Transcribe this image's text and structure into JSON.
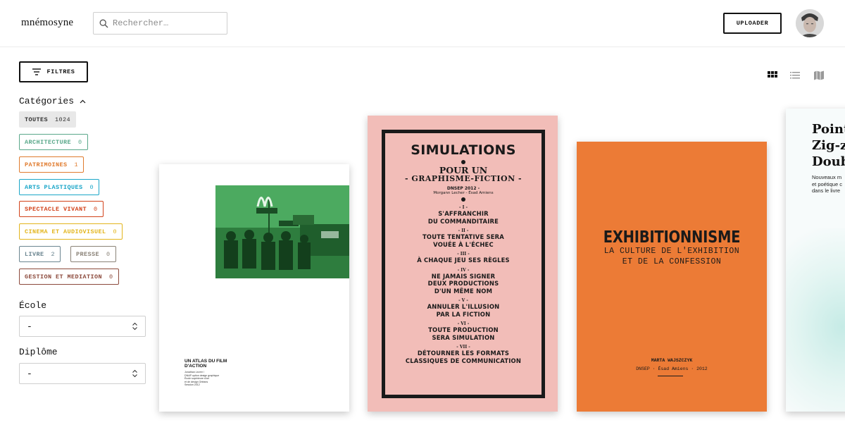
{
  "app": {
    "logo": "mnémosyne",
    "search_placeholder": "Rechercher…",
    "upload_label": "UPLOADER"
  },
  "sidebar": {
    "filter_label": "FILTRES",
    "categories_label": "Catégories",
    "categories": [
      {
        "label": "TOUTES",
        "count": "1024",
        "color": "#e8e8e8",
        "selected": true
      },
      {
        "label": "ARCHITECTURE",
        "count": "0",
        "color": "#5aa88a"
      },
      {
        "label": "PATRIMOINES",
        "count": "1",
        "color": "#e07b2e"
      },
      {
        "label": "ARTS PLASTIQUES",
        "count": "0",
        "color": "#1aa6c8"
      },
      {
        "label": "SPECTACLE VIVANT",
        "count": "0",
        "color": "#d2421a"
      },
      {
        "label": "CINEMA ET AUDIOVISUEL",
        "count": "0",
        "color": "#e3b51c"
      },
      {
        "label": "LIVRE",
        "count": "2",
        "color": "#6b8590"
      },
      {
        "label": "PRESSE",
        "count": "0",
        "color": "#8a8277"
      },
      {
        "label": "GESTION ET MEDIATION",
        "count": "0",
        "color": "#8c4a3c"
      }
    ],
    "school_label": "École",
    "school_value": "-",
    "diploma_label": "Diplôme",
    "diploma_value": "-"
  },
  "views": [
    "grid-view-icon",
    "list-view-icon",
    "map-view-icon"
  ],
  "cards": [
    {
      "title": "UN ATLAS DU FILM D'ACTION",
      "lines": [
        "Jonathan Levrer /",
        "DNAP option design graphique",
        "École supérieure d'art",
        "et de design Orléans",
        "Session 2012"
      ],
      "image": "fast-food-soldiers-photo"
    },
    {
      "title": "SIMULATIONS",
      "subtitle1": "POUR UN",
      "subtitle2": "- GRAPHISME-FICTION -",
      "meta1": "DNSEP 2012 -",
      "meta2": "Morgann Lecher - Ésad Amiens",
      "items": [
        {
          "num": "- I -",
          "text": [
            "S'AFFRANCHIR",
            "DU COMMANDITAIRE"
          ]
        },
        {
          "num": "- II -",
          "text": [
            "TOUTE TENTATIVE SERA",
            "VOUÉE À L'ÉCHEC"
          ]
        },
        {
          "num": "- III -",
          "text": [
            "À CHAQUE JEU SES RÈGLES"
          ]
        },
        {
          "num": "- IV -",
          "text": [
            "NE JAMAIS SIGNER",
            "DEUX PRODUCTIONS",
            "D'UN MÊME NOM"
          ]
        },
        {
          "num": "- V -",
          "text": [
            "ANNULER L'ILLUSION",
            "PAR LA FICTION"
          ]
        },
        {
          "num": "- VI -",
          "text": [
            "TOUTE PRODUCTION",
            "SERA SIMULATION"
          ]
        },
        {
          "num": "- VII -",
          "text": [
            "DÉTOURNER LES FORMATS",
            "CLASSIQUES DE COMMUNICATION"
          ]
        }
      ]
    },
    {
      "title": "EXHIBITIONNISME",
      "subtitle1": "LA CULTURE DE L'EXHIBITION",
      "subtitle2": "ET DE LA CONFESSION",
      "author": "MARTA WAJSZCZYK",
      "school": "DNSEP · Ésad Amiens · 2012"
    },
    {
      "title_lines": [
        "Point",
        "Zig-z",
        "Doub"
      ],
      "desc_lines": [
        "Nouveaux m",
        "et poétique c",
        "dans le livre"
      ]
    }
  ]
}
